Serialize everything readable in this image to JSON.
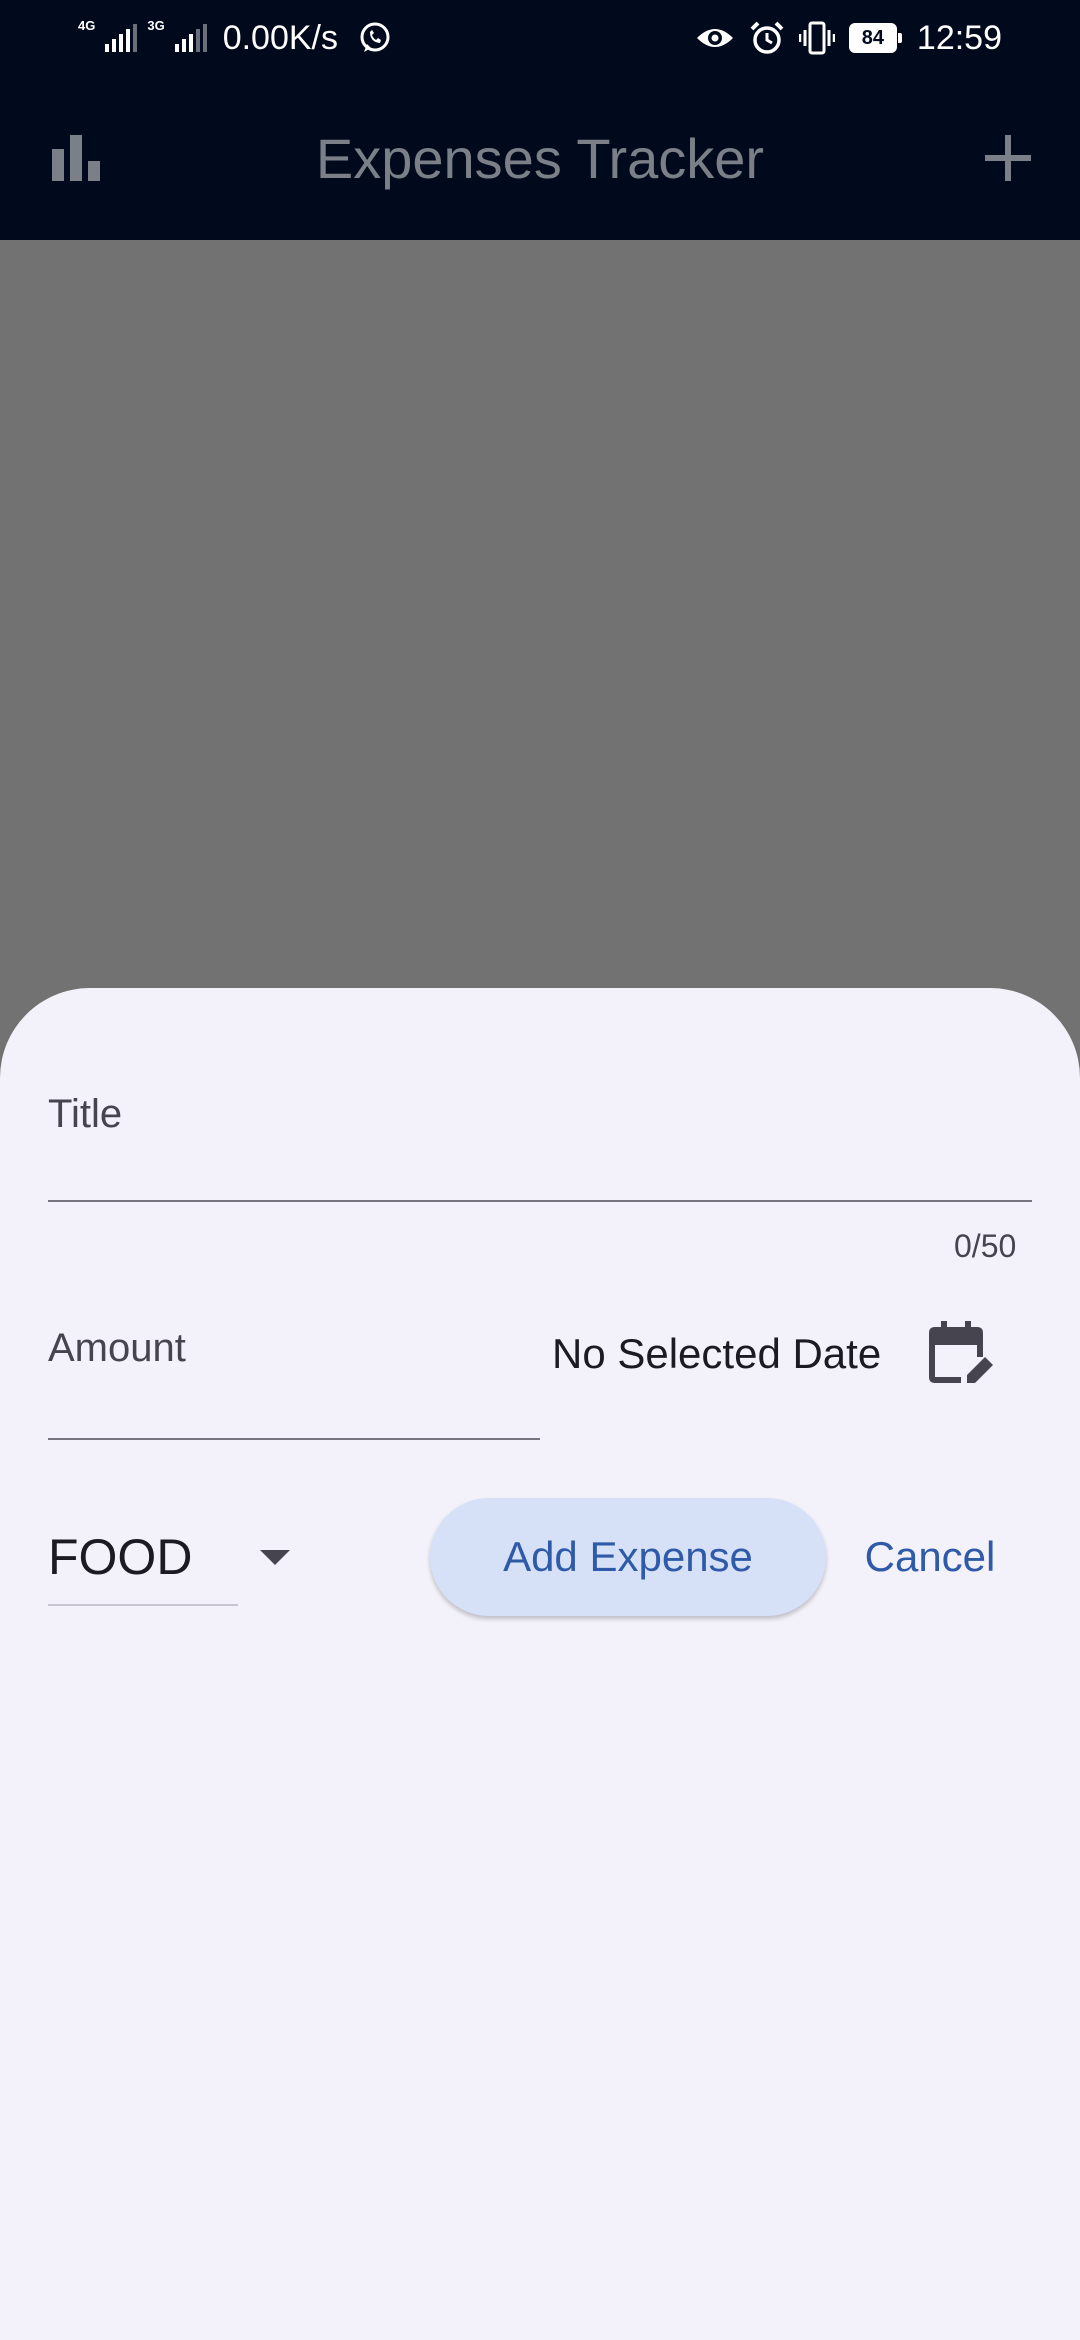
{
  "status_bar": {
    "network_1": "4G",
    "network_2": "3G",
    "net_speed": "0.00K/s",
    "battery": "84",
    "time": "12:59",
    "icons": [
      "whatsapp-icon",
      "eye-icon",
      "alarm-icon",
      "vibrate-icon",
      "battery-icon"
    ]
  },
  "app_bar": {
    "title": "Expenses Tracker",
    "left_icon": "bar-chart-icon",
    "right_icon": "plus-icon"
  },
  "form": {
    "title_label": "Title",
    "title_counter": "0/50",
    "amount_label": "Amount",
    "date_text": "No Selected Date",
    "calendar_icon": "calendar-edit-icon",
    "category_value": "FOOD",
    "add_label": "Add Expense",
    "cancel_label": "Cancel"
  },
  "colors": {
    "app_bar_bg": "#010a1c",
    "scrim": "#727272",
    "sheet_bg": "#f3f2fa",
    "primary": "#2f5aa8",
    "button_container": "#d6e1f8"
  }
}
